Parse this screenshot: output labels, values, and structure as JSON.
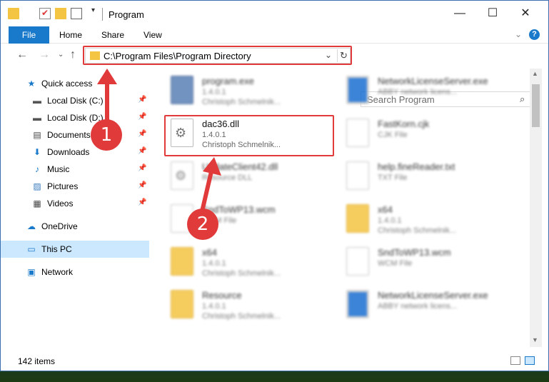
{
  "window": {
    "title": "Program",
    "minimize": "—",
    "maximize": "☐",
    "close": "✕"
  },
  "ribbon": {
    "file": "File",
    "home": "Home",
    "share": "Share",
    "view": "View",
    "help": "?"
  },
  "nav": {
    "back": "←",
    "forward": "→",
    "recent": "⌄",
    "up": "↑",
    "address": "C:\\Program Files\\Program Directory",
    "address_dropdown": "⌄",
    "refresh": "↻",
    "search_placeholder": "Search Program",
    "search_icon": "⌕"
  },
  "sidebar": {
    "items": [
      {
        "label": "Quick access",
        "icon": "star-icon",
        "glyph": "★",
        "color": "#1979ca"
      },
      {
        "label": "Local Disk (C:)",
        "icon": "drive-icon",
        "glyph": "▬",
        "color": "#555",
        "pin": "📌"
      },
      {
        "label": "Local Disk (D:)",
        "icon": "drive-icon",
        "glyph": "▬",
        "color": "#555",
        "pin": "📌"
      },
      {
        "label": "Documents",
        "icon": "documents-icon",
        "glyph": "▤",
        "color": "#444",
        "pin": "📌"
      },
      {
        "label": "Downloads",
        "icon": "downloads-icon",
        "glyph": "⬇",
        "color": "#1979ca",
        "pin": "📌"
      },
      {
        "label": "Music",
        "icon": "music-icon",
        "glyph": "♪",
        "color": "#1979ca",
        "pin": "📌"
      },
      {
        "label": "Pictures",
        "icon": "pictures-icon",
        "glyph": "▨",
        "color": "#3a7bbf",
        "pin": "📌"
      },
      {
        "label": "Videos",
        "icon": "videos-icon",
        "glyph": "▦",
        "color": "#444",
        "pin": "📌"
      },
      {
        "label": "OneDrive",
        "icon": "cloud-icon",
        "glyph": "☁",
        "color": "#1979ca"
      },
      {
        "label": "This PC",
        "icon": "computer-icon",
        "glyph": "▭",
        "color": "#1979ca"
      },
      {
        "label": "Network",
        "icon": "network-icon",
        "glyph": "▣",
        "color": "#1979ca"
      }
    ]
  },
  "files": [
    {
      "name": "program.exe",
      "line1": "1.4.0.1",
      "line2": "Christoph Schmelnik...",
      "icon": "app-icon"
    },
    {
      "name": "NetworkLicenseServer.exe",
      "line1": "ABBY network licens...",
      "line2": "",
      "icon": "blue-app-icon"
    },
    {
      "name": "dac36.dll",
      "line1": "1.4.0.1",
      "line2": "Christoph Schmelnik...",
      "icon": "gear-file-icon"
    },
    {
      "name": "FastKorn.cjk",
      "line1": "CJK File",
      "line2": "",
      "icon": "document-icon"
    },
    {
      "name": "UpdateClient42.dll",
      "line1": "Resource DLL",
      "line2": "",
      "icon": "gear-file-icon"
    },
    {
      "name": "help.fineReader.txt",
      "line1": "TXT File",
      "line2": "",
      "icon": "document-icon"
    },
    {
      "name": "SndToWP13.wcm",
      "line1": "WCM File",
      "line2": "",
      "icon": "document-icon"
    },
    {
      "name": "x64",
      "line1": "1.4.0.1",
      "line2": "Christoph Schmelnik...",
      "icon": "folder-icon"
    },
    {
      "name": "x64",
      "line1": "1.4.0.1",
      "line2": "Christoph Schmelnik...",
      "icon": "folder-icon"
    },
    {
      "name": "SndToWP13.wcm",
      "line1": "WCM File",
      "line2": "",
      "icon": "document-icon"
    },
    {
      "name": "Resource",
      "line1": "1.4.0.1",
      "line2": "Christoph Schmelnik...",
      "icon": "folder-icon"
    },
    {
      "name": "NetworkLicenseServer.exe",
      "line1": "ABBY network licens...",
      "line2": "",
      "icon": "blue-app-icon"
    }
  ],
  "status": {
    "count": "142 items"
  },
  "annotations": {
    "step1": "1",
    "step2": "2",
    "color": "#e03a3a"
  }
}
